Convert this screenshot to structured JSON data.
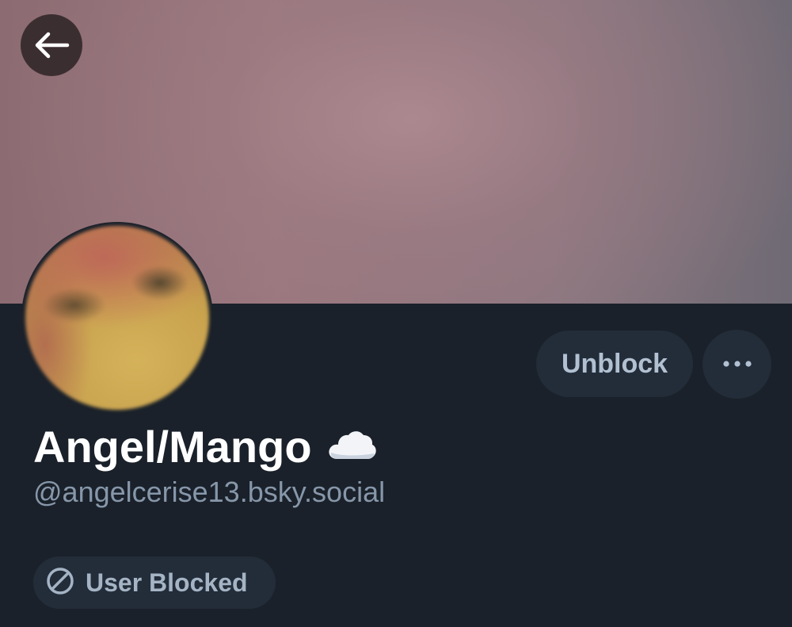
{
  "profile": {
    "display_name": "Angel/Mango",
    "handle": "@angelcerise13.bsky.social",
    "status_emoji_icon": "cloud-icon"
  },
  "actions": {
    "back_icon": "arrow-left-icon",
    "unblock_label": "Unblock",
    "more_icon": "ellipsis-icon"
  },
  "status": {
    "blocked_label": "User Blocked",
    "blocked_icon": "block-icon"
  },
  "colors": {
    "background": "#1a212a",
    "button_bg": "#232d39",
    "button_text": "#b2c1d2",
    "name_text": "#ffffff",
    "handle_text": "#8797aa"
  }
}
